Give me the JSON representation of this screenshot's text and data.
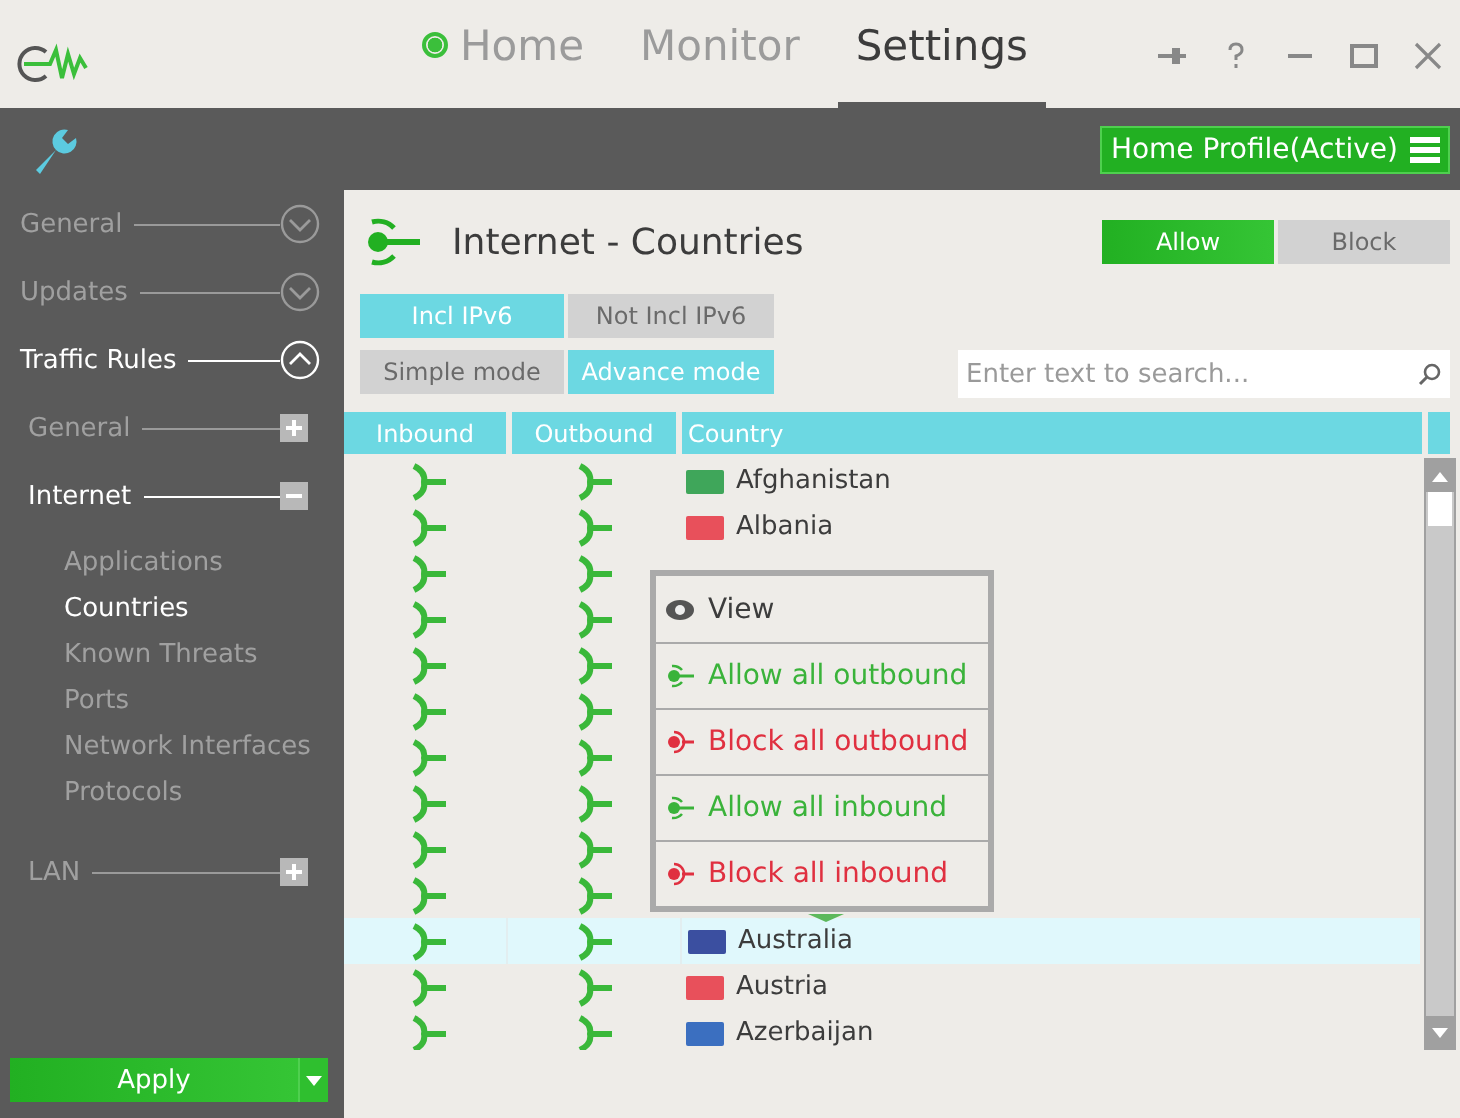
{
  "tabs": [
    {
      "label": "Home",
      "selected": false,
      "indicator": true
    },
    {
      "label": "Monitor",
      "selected": false,
      "indicator": false
    },
    {
      "label": "Settings",
      "selected": true,
      "indicator": false
    }
  ],
  "profile": {
    "label": "Home Profile(Active)"
  },
  "sidebar": {
    "items": [
      {
        "label": "General",
        "expanded": false
      },
      {
        "label": "Updates",
        "expanded": false
      },
      {
        "label": "Traffic Rules",
        "expanded": true,
        "children": [
          {
            "label": "General",
            "expanded": false
          },
          {
            "label": "Internet",
            "expanded": true,
            "children": [
              {
                "label": "Applications",
                "selected": false
              },
              {
                "label": "Countries",
                "selected": true
              },
              {
                "label": "Known Threats",
                "selected": false
              },
              {
                "label": "Ports",
                "selected": false
              },
              {
                "label": "Network Interfaces",
                "selected": false
              },
              {
                "label": "Protocols",
                "selected": false
              }
            ]
          },
          {
            "label": "LAN",
            "expanded": false
          }
        ]
      }
    ],
    "apply_button": "Apply"
  },
  "content": {
    "title": "Internet - Countries",
    "policy": [
      {
        "label": "Allow",
        "selected": true
      },
      {
        "label": "Block",
        "selected": false
      }
    ],
    "ip_filter": [
      {
        "label": "Incl IPv6",
        "selected": true
      },
      {
        "label": "Not Incl IPv6",
        "selected": false
      }
    ],
    "mode": [
      {
        "label": "Simple mode",
        "selected": false
      },
      {
        "label": "Advance mode",
        "selected": true
      }
    ],
    "search": {
      "placeholder": "Enter text to search..."
    },
    "table": {
      "columns": [
        "Inbound",
        "Outbound",
        "Country"
      ],
      "rows": [
        {
          "country": "Afghanistan",
          "color": "#3fa65a",
          "selected": false
        },
        {
          "country": "Albania",
          "color": "#e8505b",
          "selected": false
        },
        {
          "selected": false
        },
        {
          "selected": false
        },
        {
          "selected": false
        },
        {
          "selected": false
        },
        {
          "selected": false
        },
        {
          "selected": false
        },
        {
          "selected": false
        },
        {
          "selected": false
        },
        {
          "country": "Australia",
          "color": "#3b4fa0",
          "selected": true
        },
        {
          "country": "Austria",
          "color": "#e8505b",
          "selected": false
        },
        {
          "country": "Azerbaijan",
          "color": "#3b6fc0",
          "selected": false
        }
      ]
    },
    "context_menu": [
      {
        "label": "View",
        "kind": "view"
      },
      {
        "label": "Allow all outbound",
        "kind": "allow"
      },
      {
        "label": "Block all outbound",
        "kind": "block"
      },
      {
        "label": "Allow all inbound",
        "kind": "allow"
      },
      {
        "label": "Block all inbound",
        "kind": "block"
      }
    ]
  }
}
